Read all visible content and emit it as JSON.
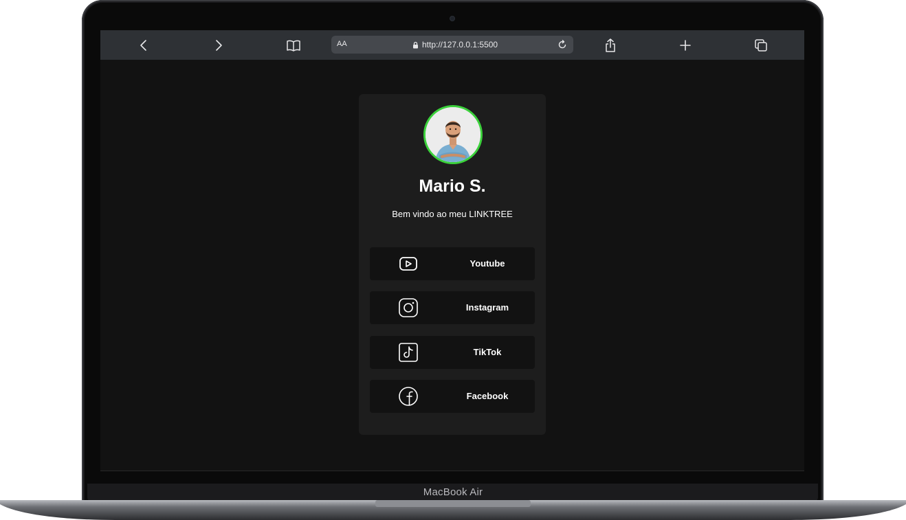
{
  "device": {
    "label": "MacBook Air"
  },
  "browser": {
    "text_size_label": "AA",
    "url": "http://127.0.0.1:5500",
    "icons": {
      "back": "chevron-left-icon",
      "forward": "chevron-right-icon",
      "bookmarks": "book-icon",
      "lock": "lock-icon",
      "reload": "reload-icon",
      "share": "share-icon",
      "new_tab": "plus-icon",
      "tabs": "tabs-icon"
    }
  },
  "profile": {
    "name": "Mario S.",
    "subtitle": "Bem vindo ao meu LINKTREE",
    "avatar_ring_color": "#3bd13b"
  },
  "links": [
    {
      "label": "Youtube",
      "icon": "youtube-icon"
    },
    {
      "label": "Instagram",
      "icon": "instagram-icon"
    },
    {
      "label": "TikTok",
      "icon": "tiktok-icon"
    },
    {
      "label": "Facebook",
      "icon": "facebook-icon"
    }
  ],
  "colors": {
    "page_background": "#121212",
    "card_background": "#1d1d1d",
    "button_background": "#121212",
    "toolbar_background": "#2e3135",
    "accent": "#3bd13b"
  }
}
